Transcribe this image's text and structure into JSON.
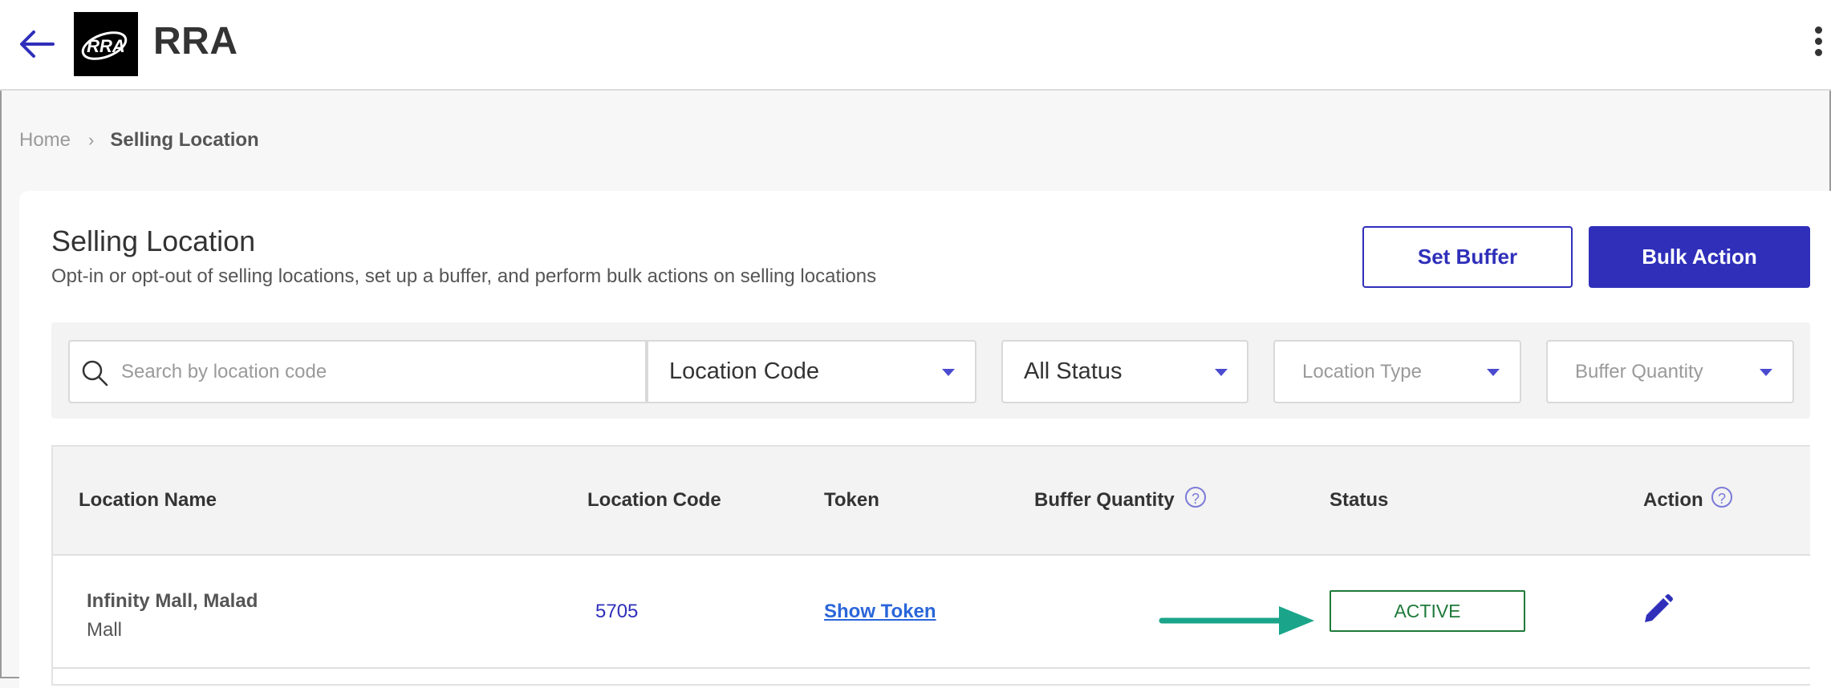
{
  "header": {
    "title": "RRA",
    "logo_text": "RRA",
    "icons": {
      "back": "arrow-left-icon",
      "menu": "kebab-menu-icon"
    }
  },
  "breadcrumb": {
    "home": "Home",
    "separator": "›",
    "current": "Selling Location"
  },
  "page": {
    "title": "Selling Location",
    "subtitle": "Opt-in or opt-out of selling locations, set up a buffer, and perform bulk actions on selling locations"
  },
  "actions": {
    "set_buffer": "Set Buffer",
    "bulk_action": "Bulk Action"
  },
  "filters": {
    "search_placeholder": "Search by location code",
    "search_by": "Location Code",
    "status": "All Status",
    "location_type": "Location Type",
    "buffer_quantity": "Buffer Quantity"
  },
  "table": {
    "columns": [
      "Location Name",
      "Location Code",
      "Token",
      "Buffer Quantity",
      "Status",
      "Action"
    ],
    "help_glyph": "?",
    "rows": [
      {
        "name": "Infinity Mall, Malad",
        "type": "Mall",
        "code": "5705",
        "token": "Show Token",
        "buffer_quantity": "",
        "status": "ACTIVE"
      }
    ]
  },
  "colors": {
    "primary": "#2f2fba",
    "status_active": "#1f7a3a",
    "link": "#2a66d9",
    "annotation_arrow": "#1aa58a"
  }
}
